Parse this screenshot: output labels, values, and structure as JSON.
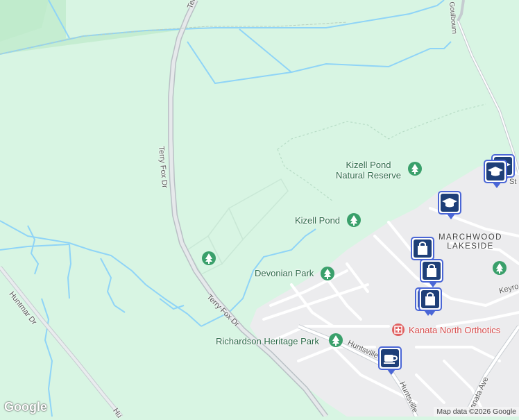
{
  "map": {
    "colors": {
      "land": "#d8f5e3",
      "field": "#c7f0d4",
      "urban": "#ececec",
      "water": "#8fd4f7",
      "road_major": "#c2c8cc",
      "road_minor": "#ffffff",
      "park_icon": "#3aa06b",
      "pin_border": "#4a66d6",
      "pin_fill": "#1e3f78",
      "hospital": "#e06060"
    },
    "area_labels": {
      "marchwood_line1": "MARCHWOOD",
      "marchwood_line2": "LAKESIDE"
    },
    "parks": {
      "kizell_reserve_line1": "Kizell Pond",
      "kizell_reserve_line2": "Natural Reserve",
      "kizell_pond": "Kizell Pond",
      "devonian_park": "Devonian Park",
      "richardson_park": "Richardson Heritage Park"
    },
    "roads": {
      "terry_fox_top": "Terry",
      "terry_fox_mid": "Terry Fox Dr",
      "terry_fox_low": "Terry Fox Dr",
      "huntmar_dr": "Huntmar Dr",
      "huntmar_bottom": "Hu",
      "goulbourn": "Goulbourn",
      "huntsville_1": "Huntsville",
      "huntsville_2": "Huntsville",
      "kanata_ave": "Kanata Ave",
      "keyro": "Keyro",
      "st_fragment": "St"
    },
    "pois": {
      "kanata_north_orthotics": "Kanata North Orthotics"
    },
    "markers": [
      {
        "icon": "school-icon"
      },
      {
        "icon": "school-icon"
      },
      {
        "icon": "shopping-bag-icon"
      },
      {
        "icon": "shopping-bag-icon"
      },
      {
        "icon": "shopping-bag-icon"
      },
      {
        "icon": "cafe-icon"
      }
    ],
    "branding": {
      "logo": "Google",
      "attribution": "Map data ©2026 Google"
    }
  }
}
